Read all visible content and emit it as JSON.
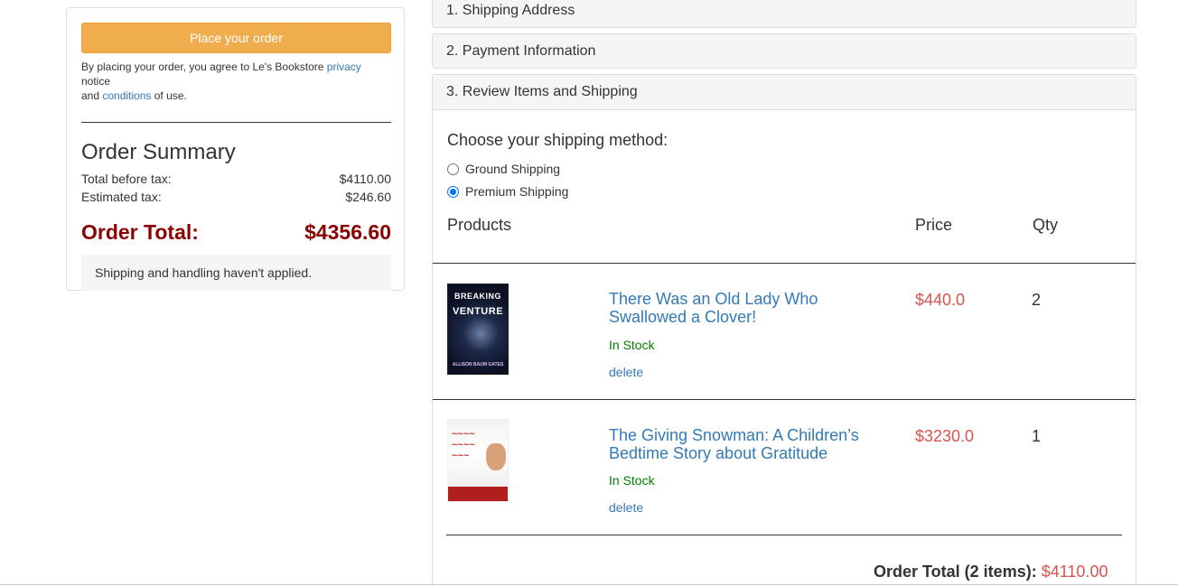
{
  "summary": {
    "place_order_label": "Place your order",
    "agree_prefix": "By placing your order, you agree to Le's Bookstore ",
    "privacy_link": "privacy",
    "agree_middle": " notice",
    "agree_line2_prefix": "and ",
    "conditions_link": "conditions",
    "agree_suffix": " of use.",
    "title": "Order Summary",
    "rows": [
      {
        "label": "Total before tax:",
        "value": "$4110.00"
      },
      {
        "label": "Estimated tax:",
        "value": "$246.60"
      }
    ],
    "order_total_label": "Order Total:",
    "order_total_value": "$4356.60",
    "notice": "Shipping and handling haven't applied."
  },
  "sections": {
    "shipping_address": "1. Shipping Address",
    "payment_information": "2. Payment Information",
    "review_items": "3. Review Items and Shipping"
  },
  "shipping": {
    "title": "Choose your shipping method:",
    "options": [
      {
        "label": "Ground Shipping",
        "selected": false
      },
      {
        "label": "Premium Shipping",
        "selected": true
      }
    ]
  },
  "table": {
    "headers": {
      "products": "Products",
      "price": "Price",
      "qty": "Qty"
    },
    "items": [
      {
        "title": "There Was an Old Lady Who Swallowed a Clover!",
        "stock": "In Stock",
        "delete": "delete",
        "price": "$440.0",
        "qty": "2",
        "cover": {
          "line1": "BREAKING",
          "line2": "VENTURE",
          "author": "ALLISON BAUM GATES"
        }
      },
      {
        "title": "The Giving Snowman: A Children’s Bedtime Story about Gratitude",
        "stock": "In Stock",
        "delete": "delete",
        "price": "$3230.0",
        "qty": "1"
      }
    ]
  },
  "footer": {
    "label": "Order Total (2 items):",
    "value": "$4110.00"
  },
  "colors": {
    "button": "#f0ad4e",
    "order_total": "#8b0000",
    "price": "#d9534f",
    "link": "#337ab7",
    "in_stock": "#008000"
  }
}
